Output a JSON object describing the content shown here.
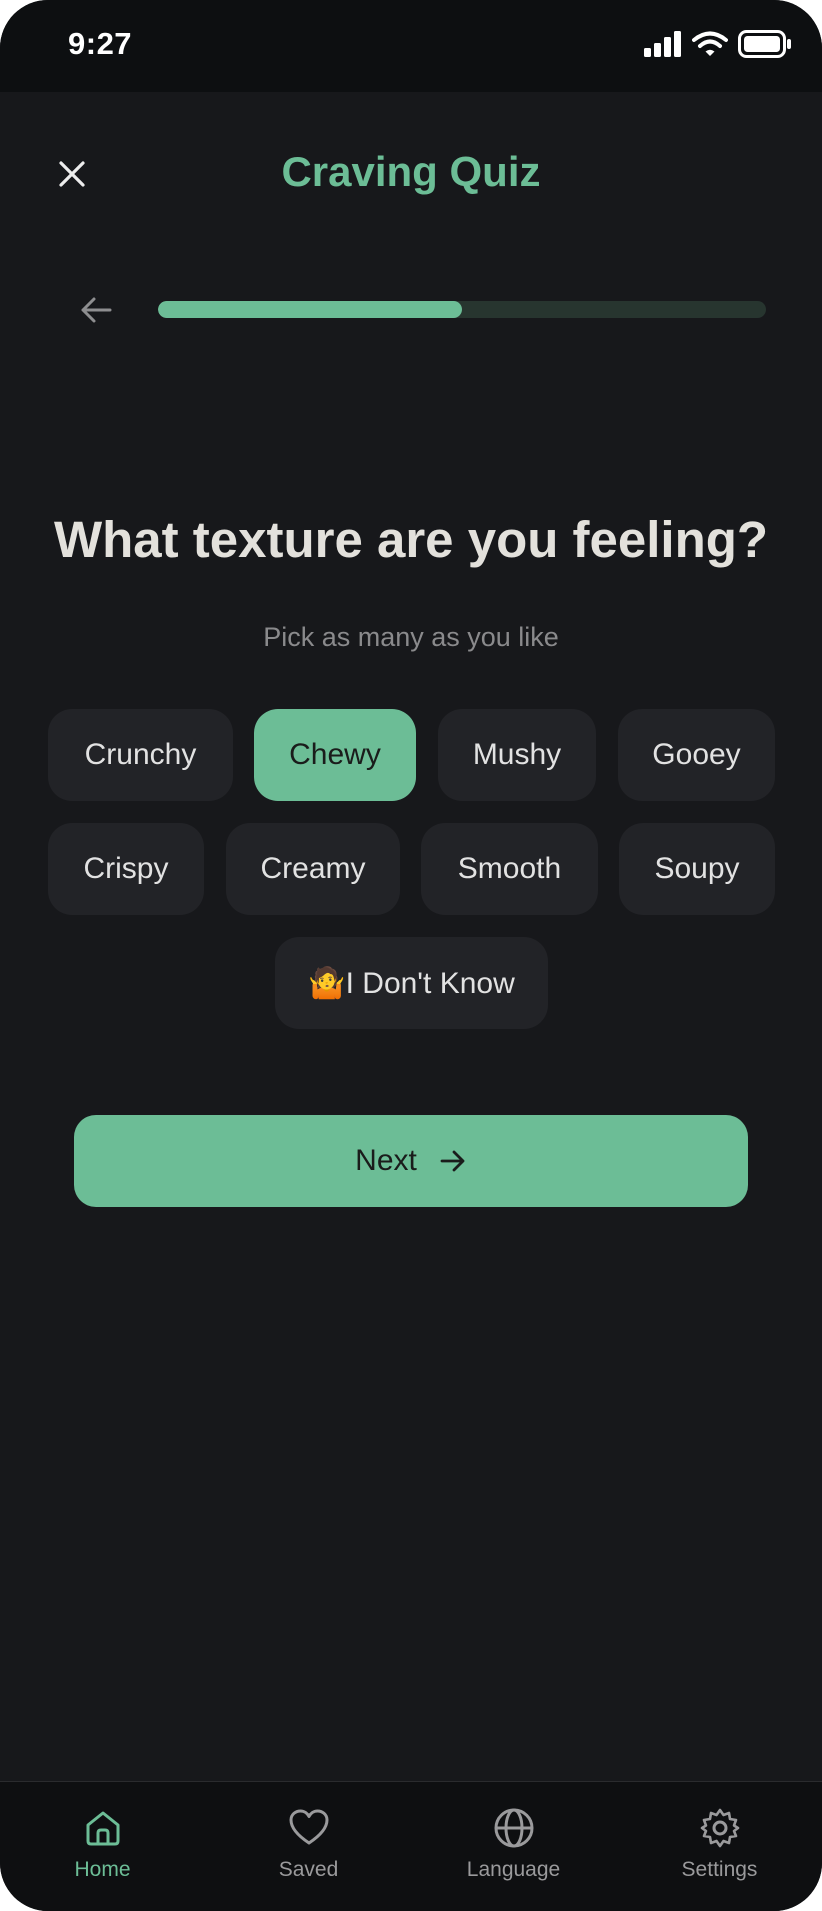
{
  "status_bar": {
    "time": "9:27"
  },
  "header": {
    "title": "Craving Quiz"
  },
  "progress": {
    "fraction": 0.5
  },
  "question": {
    "title": "What texture are you feeling?",
    "hint": "Pick as many as you like"
  },
  "options": [
    {
      "label": "Crunchy",
      "selected": false
    },
    {
      "label": "Chewy",
      "selected": true
    },
    {
      "label": "Mushy",
      "selected": false
    },
    {
      "label": "Gooey",
      "selected": false
    },
    {
      "label": "Crispy",
      "selected": false
    },
    {
      "label": "Creamy",
      "selected": false
    },
    {
      "label": "Smooth",
      "selected": false
    },
    {
      "label": "Soupy",
      "selected": false
    },
    {
      "label": "🤷I Don't Know",
      "selected": false
    }
  ],
  "next_button": {
    "label": "Next"
  },
  "tabs": [
    {
      "label": "Home",
      "icon": "home-icon",
      "active": true
    },
    {
      "label": "Saved",
      "icon": "heart-icon",
      "active": false
    },
    {
      "label": "Language",
      "icon": "globe-icon",
      "active": false
    },
    {
      "label": "Settings",
      "icon": "gear-icon",
      "active": false
    }
  ],
  "colors": {
    "accent": "#6cbd96",
    "background": "#17181b",
    "chip": "#222327",
    "track": "#27352f"
  }
}
